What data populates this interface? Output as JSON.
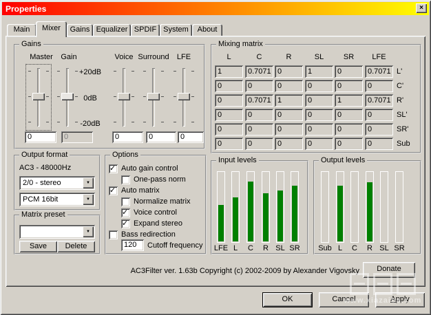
{
  "window": {
    "title": "Properties"
  },
  "icons": {
    "close": "×",
    "dropdown_arrow": "▼",
    "check": "✓"
  },
  "tabs": [
    {
      "label": "Main",
      "active": false
    },
    {
      "label": "Mixer",
      "active": true
    },
    {
      "label": "Gains",
      "active": false
    },
    {
      "label": "Equalizer",
      "active": false
    },
    {
      "label": "SPDIF",
      "active": false
    },
    {
      "label": "System",
      "active": false
    },
    {
      "label": "About",
      "active": false
    }
  ],
  "gains": {
    "title": "Gains",
    "scale_labels": [
      "+20dB",
      "0dB",
      "-20dB"
    ],
    "sliders": [
      {
        "label": "Master",
        "value": "0",
        "disabled": false,
        "focused": true
      },
      {
        "label": "Gain",
        "value": "0",
        "disabled": true,
        "focused": false
      },
      {
        "label": "Voice",
        "value": "0",
        "disabled": false,
        "focused": false
      },
      {
        "label": "Surround",
        "value": "0",
        "disabled": false,
        "focused": false
      },
      {
        "label": "LFE",
        "value": "0",
        "disabled": false,
        "focused": false
      }
    ]
  },
  "mixing_matrix": {
    "title": "Mixing matrix",
    "col_headers": [
      "L",
      "C",
      "R",
      "SL",
      "SR",
      "LFE"
    ],
    "row_labels": [
      "L'",
      "C'",
      "R'",
      "SL'",
      "SR'",
      "Sub"
    ],
    "rows": [
      [
        "1",
        "0.7071",
        "0",
        "1",
        "0",
        "0.7071"
      ],
      [
        "0",
        "0",
        "0",
        "0",
        "0",
        "0"
      ],
      [
        "0",
        "0.7071",
        "1",
        "0",
        "1",
        "0.7071"
      ],
      [
        "0",
        "0",
        "0",
        "0",
        "0",
        "0"
      ],
      [
        "0",
        "0",
        "0",
        "0",
        "0",
        "0"
      ],
      [
        "0",
        "0",
        "0",
        "0",
        "0",
        "0"
      ]
    ]
  },
  "output_format": {
    "title": "Output format",
    "format_label": "AC3 - 48000Hz",
    "speaker_value": "2/0 - stereo",
    "sample_value": "PCM 16bit"
  },
  "matrix_preset": {
    "title": "Matrix preset",
    "preset_value": "",
    "save_label": "Save",
    "delete_label": "Delete"
  },
  "options": {
    "title": "Options",
    "checkboxes": [
      {
        "label": "Auto gain control",
        "checked": true,
        "indent": 0
      },
      {
        "label": "One-pass norm",
        "checked": false,
        "indent": 1
      },
      {
        "label": "Auto matrix",
        "checked": true,
        "indent": 0
      },
      {
        "label": "Normalize matrix",
        "checked": false,
        "indent": 1
      },
      {
        "label": "Voice control",
        "checked": true,
        "indent": 1
      },
      {
        "label": "Expand stereo",
        "checked": true,
        "indent": 1
      },
      {
        "label": "Bass redirection",
        "checked": false,
        "indent": 0
      }
    ],
    "cutoff": {
      "value": "120",
      "label": "Cutoff frequency"
    }
  },
  "chart_data": [
    {
      "type": "bar",
      "title": "Input levels",
      "categories": [
        "LFE",
        "L",
        "C",
        "R",
        "SL",
        "SR"
      ],
      "values": [
        52,
        63,
        85,
        69,
        73,
        79
      ],
      "ylim": [
        0,
        100
      ],
      "bar_color": "#008000"
    },
    {
      "type": "bar",
      "title": "Output levels",
      "categories": [
        "Sub",
        "L",
        "C",
        "R",
        "SL",
        "SR"
      ],
      "values": [
        0,
        79,
        0,
        84,
        0,
        0
      ],
      "ylim": [
        0,
        100
      ],
      "bar_color": "#008000"
    }
  ],
  "input_levels": {
    "title": "Input levels",
    "channels": [
      "LFE",
      "L",
      "C",
      "R",
      "SL",
      "SR"
    ],
    "values": [
      52,
      63,
      85,
      69,
      73,
      79
    ]
  },
  "output_levels": {
    "title": "Output levels",
    "channels": [
      "Sub",
      "L",
      "C",
      "R",
      "SL",
      "SR"
    ],
    "values": [
      0,
      79,
      0,
      84,
      0,
      0
    ]
  },
  "footer": {
    "copyright": "AC3Filter ver. 1.63b Copyright (c) 2002-2009 by Alexander Vigovsky",
    "donate_label": "Donate"
  },
  "buttons": {
    "ok": "OK",
    "cancel": "Cancel",
    "apply_first": "A",
    "apply_rest": "pply"
  },
  "watermark": {
    "text": "www.xiazaiba.com"
  },
  "colors": {
    "titlebar_left": "#ff0000",
    "titlebar_right": "#ffff00",
    "dialog_bg": "#d4d0c8",
    "meter_green": "#008000"
  }
}
